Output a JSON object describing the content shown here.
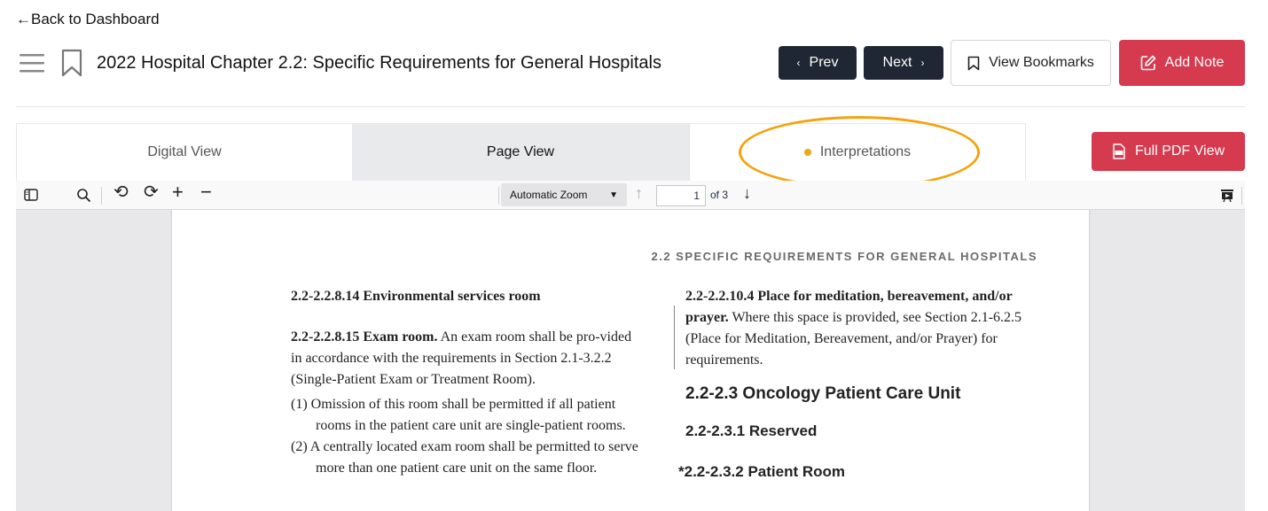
{
  "nav": {
    "back_label": "←Back to Dashboard"
  },
  "header": {
    "title": "2022 Hospital Chapter 2.2: Specific Requirements for General Hospitals",
    "prev_label": "Prev",
    "next_label": "Next",
    "view_bookmarks_label": "View Bookmarks",
    "add_note_label": "Add Note"
  },
  "tabs": [
    {
      "label": "Digital View",
      "active": false
    },
    {
      "label": "Page View",
      "active": true
    },
    {
      "label": "Interpretations",
      "active": false
    }
  ],
  "full_pdf_label": "Full PDF View",
  "toolbar": {
    "zoom": "Automatic Zoom",
    "page_number": "1",
    "page_total": "of 3"
  },
  "document": {
    "running_head": "2.2  SPECIFIC REQUIREMENTS FOR GENERAL HOSPITALS",
    "left": {
      "s14_heading": "2.2-2.2.8.14 Environmental services room",
      "s15_heading": "2.2-2.2.8.15 Exam room.",
      "s15_text": " An exam room shall be pro-vided in accordance with the requirements in Section 2.1-3.2.2 (Single-Patient Exam or Treatment Room).",
      "item1": "(1) Omission of this room shall be permitted if all patient rooms in the patient care unit are single-patient rooms.",
      "item2": "(2) A centrally located exam room shall be permitted to serve more than one patient care unit on the same floor."
    },
    "right": {
      "s104_heading": "2.2-2.2.10.4 Place for meditation, bereavement, and/or prayer.",
      "s104_text": " Where this space is provided, see Section 2.1-6.2.5 (Place for Meditation, Bereavement, and/or Prayer) for requirements.",
      "h_oncology": "2.2-2.3 Oncology Patient Care Unit",
      "h_reserved": "2.2-2.3.1 Reserved",
      "h_patient_room": "*2.2-2.3.2 Patient Room"
    }
  },
  "colors": {
    "dark_button": "#1e2733",
    "accent_red": "#d53a4f",
    "highlight": "#f4a30c",
    "dot": "#e8a817"
  }
}
